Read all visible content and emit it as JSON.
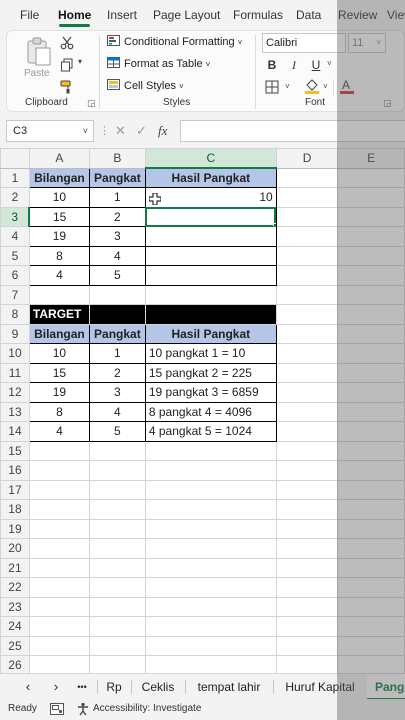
{
  "menu": {
    "tabs": [
      "File",
      "Home",
      "Insert",
      "Page Layout",
      "Formulas",
      "Data",
      "Review",
      "View"
    ],
    "active": "Home"
  },
  "ribbon": {
    "clipboard": {
      "paste_label": "Paste",
      "group_label": "Clipboard"
    },
    "styles": {
      "conditional_formatting": "Conditional Formatting",
      "format_as_table": "Format as Table",
      "cell_styles": "Cell Styles",
      "group_label": "Styles"
    },
    "font": {
      "name": "Calibri",
      "size": "11",
      "group_label": "Font"
    }
  },
  "formula_bar": {
    "name_box": "C3",
    "fx_label": "fx",
    "formula": ""
  },
  "grid": {
    "columns": [
      "A",
      "B",
      "C",
      "D",
      "E"
    ],
    "rows": [
      {
        "n": "1",
        "a": "Bilangan",
        "b": "Pangkat",
        "c": "Hasil Pangkat"
      },
      {
        "n": "2",
        "a": "10",
        "b": "1",
        "c": "10"
      },
      {
        "n": "3",
        "a": "15",
        "b": "2",
        "c": ""
      },
      {
        "n": "4",
        "a": "19",
        "b": "3",
        "c": ""
      },
      {
        "n": "5",
        "a": "8",
        "b": "4",
        "c": ""
      },
      {
        "n": "6",
        "a": "4",
        "b": "5",
        "c": ""
      },
      {
        "n": "7",
        "a": "",
        "b": "",
        "c": ""
      },
      {
        "n": "8",
        "a": "TARGET",
        "b": "",
        "c": ""
      },
      {
        "n": "9",
        "a": "Bilangan",
        "b": "Pangkat",
        "c": "Hasil Pangkat"
      },
      {
        "n": "10",
        "a": "10",
        "b": "1",
        "c": "10 pangkat 1 = 10"
      },
      {
        "n": "11",
        "a": "15",
        "b": "2",
        "c": "15 pangkat 2 = 225"
      },
      {
        "n": "12",
        "a": "19",
        "b": "3",
        "c": "19 pangkat 3 = 6859"
      },
      {
        "n": "13",
        "a": "8",
        "b": "4",
        "c": "8 pangkat 4 = 4096"
      },
      {
        "n": "14",
        "a": "4",
        "b": "5",
        "c": "4 pangkat 5 = 1024"
      },
      {
        "n": "15",
        "a": "",
        "b": "",
        "c": ""
      },
      {
        "n": "16",
        "a": "",
        "b": "",
        "c": ""
      },
      {
        "n": "17",
        "a": "",
        "b": "",
        "c": ""
      },
      {
        "n": "18",
        "a": "",
        "b": "",
        "c": ""
      },
      {
        "n": "19",
        "a": "",
        "b": "",
        "c": ""
      },
      {
        "n": "20",
        "a": "",
        "b": "",
        "c": ""
      },
      {
        "n": "21",
        "a": "",
        "b": "",
        "c": ""
      },
      {
        "n": "22",
        "a": "",
        "b": "",
        "c": ""
      },
      {
        "n": "23",
        "a": "",
        "b": "",
        "c": ""
      },
      {
        "n": "24",
        "a": "",
        "b": "",
        "c": ""
      },
      {
        "n": "25",
        "a": "",
        "b": "",
        "c": ""
      },
      {
        "n": "26",
        "a": "",
        "b": "",
        "c": ""
      }
    ]
  },
  "sheets": {
    "more": "•••",
    "tabs": [
      "Rp",
      "Ceklis",
      "tempat lahir",
      "Huruf Kapital",
      "Pangk"
    ],
    "active_index": 4
  },
  "status": {
    "ready": "Ready",
    "accessibility": "Accessibility: Investigate"
  },
  "colors": {
    "accent": "#107c41",
    "header_fill": "#b4c6e7",
    "target_fill": "#000000"
  }
}
